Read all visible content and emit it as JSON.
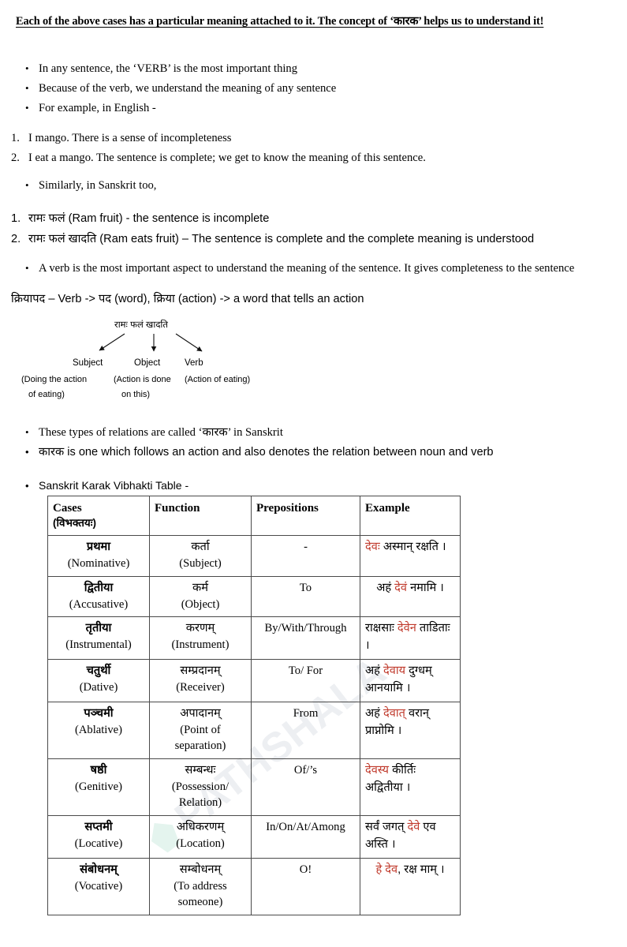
{
  "heading": "Each of the above cases has a particular meaning attached to it. The concept of ‘कारक’ helps us to understand it!",
  "intro_bullets": [
    "In any sentence, the ‘VERB’ is the most important thing",
    "Because of the verb, we understand the meaning of any sentence",
    "For example, in English -"
  ],
  "english_examples": [
    {
      "num": "1.",
      "text": "I mango. There is a sense of incompleteness"
    },
    {
      "num": "2.",
      "text": "I eat a mango. The sentence is complete; we get to know the meaning of this sentence."
    }
  ],
  "sanskrit_intro_bullet": "Similarly, in Sanskrit too,",
  "sanskrit_examples": [
    {
      "num": "1.",
      "text": "रामः फलं (Ram fruit) - the sentence is incomplete"
    },
    {
      "num": "2.",
      "text": "रामः फलं खादति (Ram eats fruit) – The sentence is complete and the complete meaning is understood"
    }
  ],
  "verb_bullet": "A verb is the most important aspect to understand the meaning of the sentence. It gives completeness to the sentence",
  "kriyapada_line": "क्रियापद – Verb -> पद (word), क्रिया (action) -> a word that tells an action",
  "diagram": {
    "sentence": "रामः फलं खादति",
    "labels": [
      {
        "label": "Subject",
        "desc_line1": "(Doing the action",
        "desc_line2": "of eating)"
      },
      {
        "label": "Object",
        "desc_line1": "(Action is done",
        "desc_line2": "on this)"
      },
      {
        "label": "Verb",
        "desc_line1": "(Action of eating)",
        "desc_line2": ""
      }
    ]
  },
  "karak_bullets": [
    "These types of relations are called ‘कारक’ in Sanskrit",
    "कारक is one which follows an action and also denotes the relation between noun and verb"
  ],
  "table_caption_bullet": "Sanskrit Karak Vibhakti Table -",
  "table": {
    "headers": [
      {
        "main": "Cases",
        "sub": "(विभक्तयः)"
      },
      {
        "main": "Function",
        "sub": ""
      },
      {
        "main": "Prepositions",
        "sub": ""
      },
      {
        "main": "Example",
        "sub": ""
      }
    ],
    "rows": [
      {
        "case_sa": "प्रथमा",
        "case_en": "(Nominative)",
        "func_sa": "कर्ता",
        "func_en": "(Subject)",
        "prep": "-",
        "ex_pre": "",
        "ex_hl": "देवः",
        "ex_post": " अस्मान् रक्षति ।"
      },
      {
        "case_sa": "द्वितीया",
        "case_en": "(Accusative)",
        "func_sa": "कर्म",
        "func_en": "(Object)",
        "prep": "To",
        "ex_pre": "अहं ",
        "ex_hl": "देवं",
        "ex_post": " नमामि ।"
      },
      {
        "case_sa": "तृतीया",
        "case_en": "(Instrumental)",
        "func_sa": "करणम्",
        "func_en": "(Instrument)",
        "prep": "By/With/Through",
        "ex_pre": "राक्षसाः ",
        "ex_hl": "देवेन",
        "ex_post": " ताडिताः ।"
      },
      {
        "case_sa": "चतुर्थी",
        "case_en": "(Dative)",
        "func_sa": "सम्प्रदानम्",
        "func_en": "(Receiver)",
        "prep": "To/ For",
        "ex_pre": "अहं ",
        "ex_hl": "देवाय",
        "ex_post": " दुग्धम् आनयामि ।"
      },
      {
        "case_sa": "पञ्चमी",
        "case_en": "(Ablative)",
        "func_sa": "अपादानम्",
        "func_en": "(Point of separation)",
        "prep": "From",
        "ex_pre": "अहं ",
        "ex_hl": "देवात्",
        "ex_post": " वरान् प्राप्नोमि ।"
      },
      {
        "case_sa": "षष्ठी",
        "case_en": "(Genitive)",
        "func_sa": "सम्बन्धः",
        "func_en": "(Possession/ Relation)",
        "prep": "Of/’s",
        "ex_pre": "",
        "ex_hl": "देवस्य",
        "ex_post": " कीर्तिः अद्वितीया ।"
      },
      {
        "case_sa": "सप्तमी",
        "case_en": "(Locative)",
        "func_sa": "अधिकरणम्",
        "func_en": "(Location)",
        "prep": "In/On/At/Among",
        "ex_pre": "सर्वं जगत् ",
        "ex_hl": "देवे",
        "ex_post": " एव अस्ति ।"
      },
      {
        "case_sa": "संबोधनम्",
        "case_en": "(Vocative)",
        "func_sa": "सम्बोधनम्",
        "func_en": "(To address someone)",
        "prep": "O!",
        "ex_pre": "",
        "ex_hl": "हे देव",
        "ex_post": ", रक्ष माम् ।"
      }
    ]
  },
  "watermark": "PATHSHALA",
  "colors": {
    "highlight": "#c0392b",
    "table_border": "#4a4a4a",
    "text": "#000000"
  }
}
